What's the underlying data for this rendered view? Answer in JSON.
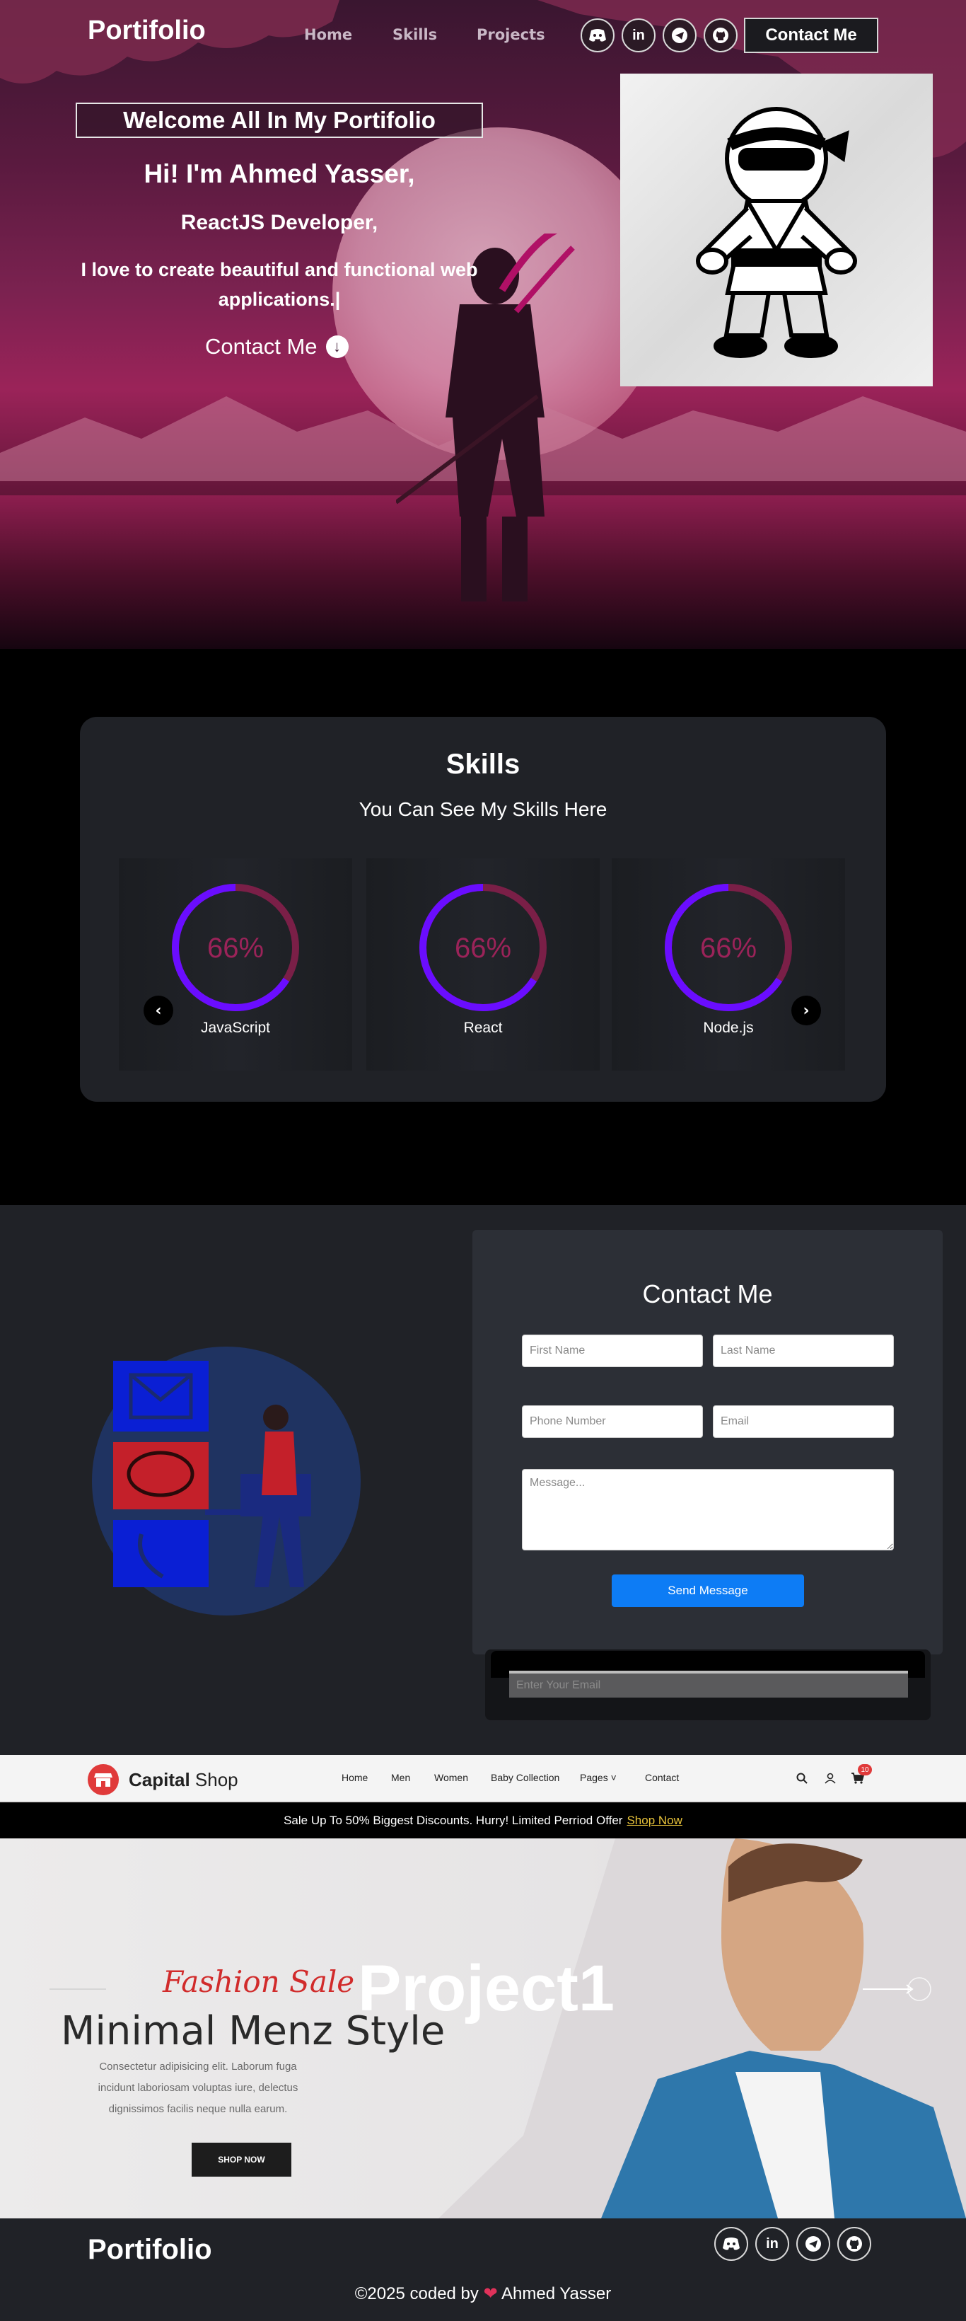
{
  "nav": {
    "brand": "Portifolio",
    "links": [
      "Home",
      "Skills",
      "Projects"
    ],
    "social_icons": [
      "discord-icon",
      "linkedin-icon",
      "telegram-icon",
      "github-icon"
    ],
    "contact_button": "Contact Me"
  },
  "hero": {
    "welcome": "Welcome All In My Portifolio",
    "greeting": "Hi! I'm Ahmed Yasser,",
    "role": "ReactJS Developer,",
    "tagline": "I love to create beautiful and functional web applications.|",
    "contact_link": "Contact Me",
    "accent_color": "#9b2359"
  },
  "skills": {
    "title": "Skills",
    "subtitle": "You Can See My Skills Here",
    "items": [
      {
        "name": "JavaScript",
        "percent_label": "66%",
        "percent": 66
      },
      {
        "name": "React",
        "percent_label": "66%",
        "percent": 66
      },
      {
        "name": "Node.js",
        "percent_label": "66%",
        "percent": 66
      }
    ],
    "ring_color": "#6a0dff",
    "track_color": "#7a1f47"
  },
  "contact": {
    "title": "Contact Me",
    "placeholders": {
      "first_name": "First Name",
      "last_name": "Last Name",
      "phone": "Phone Number",
      "email": "Email",
      "message": "Message..."
    },
    "send_button": "Send Message",
    "newsletter_placeholder": "Enter Your Email"
  },
  "project": {
    "shop": {
      "brand_bold": "Capital",
      "brand_light": " Shop",
      "links": [
        "Home",
        "Men",
        "Women",
        "Baby Collection",
        "Pages",
        "Contact"
      ],
      "cart_count": "10"
    },
    "sale_text": "Sale Up To 50% Biggest Discounts. Hurry! Limited Perriod Offer",
    "sale_link": "Shop Now",
    "fashion": "Fashion Sale",
    "headline": "Minimal Menz Style",
    "lorem": "Consectetur adipisicing elit. Laborum fuga incidunt laboriosam voluptas iure, delectus dignissimos facilis neque nulla earum.",
    "shop_button": "SHOP NOW",
    "label": "Project1"
  },
  "footer": {
    "brand": "Portifolio",
    "copy_prefix": "©2025 coded by",
    "copy_name": "Ahmed Yasser"
  }
}
